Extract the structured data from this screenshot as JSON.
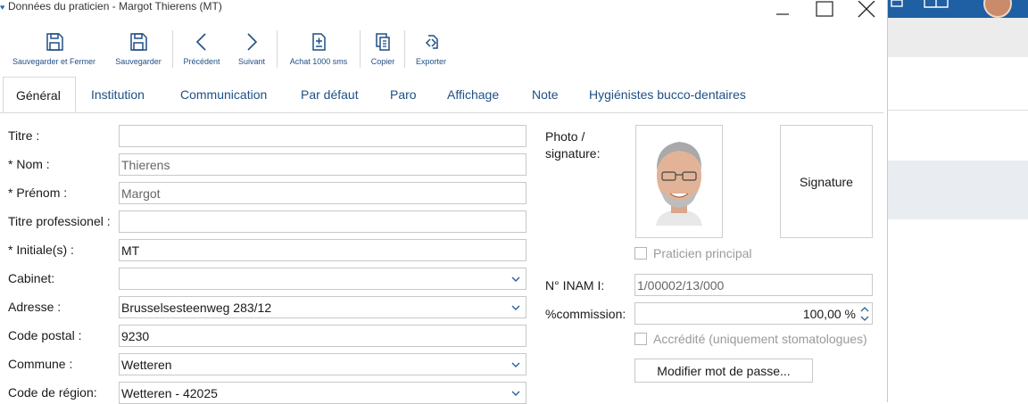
{
  "window": {
    "title": "Données du praticien - Margot Thierens (MT)"
  },
  "toolbar": {
    "save_close": "Sauvegarder et Fermer",
    "save": "Sauvegarder",
    "previous": "Précédent",
    "next": "Suivant",
    "buy_sms": "Achat 1000 sms",
    "copy": "Copier",
    "export": "Exporter"
  },
  "tabs": [
    "Général",
    "Institution",
    "Communication",
    "Par défaut",
    "Paro",
    "Affichage",
    "Note",
    "Hygiénistes bucco-dentaires"
  ],
  "form": {
    "titre": {
      "label": "Titre :",
      "value": ""
    },
    "nom": {
      "label": "* Nom :",
      "value": "Thierens"
    },
    "prenom": {
      "label": "* Prénom :",
      "value": "Margot"
    },
    "titre_pro": {
      "label": "Titre professionel :",
      "value": ""
    },
    "initiales": {
      "label": "* Initiale(s) :",
      "value": "MT"
    },
    "cabinet": {
      "label": "Cabinet:",
      "value": ""
    },
    "adresse": {
      "label": "Adresse :",
      "value": "Brusselsesteenweg 283/12"
    },
    "code_postal": {
      "label": "Code postal :",
      "value": "9230"
    },
    "commune": {
      "label": "Commune :",
      "value": "Wetteren"
    },
    "code_region": {
      "label": "Code de région:",
      "value": "Wetteren - 42025"
    }
  },
  "right": {
    "photo_label": "Photo / signature:",
    "signature": "Signature",
    "praticien_principal": "Praticien principal",
    "inami_label": "N° INAM I:",
    "inami_value": "1/00002/13/000",
    "commission_label": "%commission:",
    "commission_value": "100,00 %",
    "accredite": "Accrédité (uniquement stomatologues)",
    "password_button": "Modifier mot de passe..."
  },
  "colors": {
    "accent": "#1f4f86",
    "brand_bar": "#1f5fa3"
  },
  "icons": {
    "save_close": "floppy-icon",
    "save": "floppy-icon",
    "previous": "chevron-left-icon",
    "next": "chevron-right-icon",
    "buy_sms": "sms-document-icon",
    "copy": "copy-icon",
    "export": "export-icon",
    "dropdown": "chevron-down-icon",
    "spinner": "spinner-icon"
  }
}
